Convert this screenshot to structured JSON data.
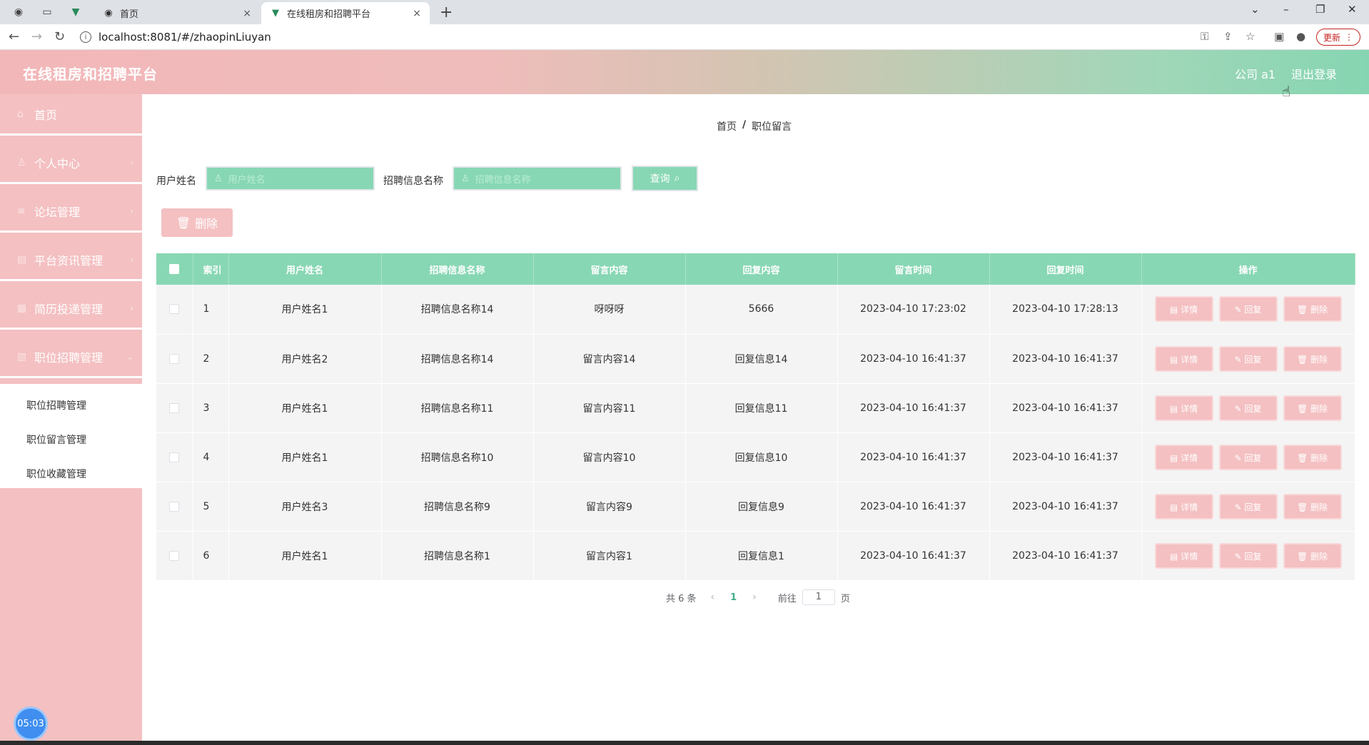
{
  "browser": {
    "tabs": [
      {
        "title": "首页",
        "close": "×"
      },
      {
        "title": "在线租房和招聘平台",
        "close": "×"
      }
    ],
    "new_tab": "+",
    "url": "localhost:8081/#/zhaopinLiuyan",
    "update_label": "更新"
  },
  "header": {
    "title": "在线租房和招聘平台",
    "user": "公司 a1",
    "logout": "退出登录"
  },
  "sidebar": {
    "items": [
      {
        "label": "首页"
      },
      {
        "label": "个人中心"
      },
      {
        "label": "论坛管理"
      },
      {
        "label": "平台资讯管理"
      },
      {
        "label": "简历投递管理"
      },
      {
        "label": "职位招聘管理"
      }
    ],
    "submenu": [
      {
        "label": "职位招聘管理"
      },
      {
        "label": "职位留言管理"
      },
      {
        "label": "职位收藏管理"
      }
    ],
    "clock": "05:03"
  },
  "breadcrumb": {
    "home": "首页",
    "sep": "/",
    "current": "职位留言"
  },
  "search": {
    "user_label": "用户姓名",
    "user_placeholder": "用户姓名",
    "job_label": "招聘信息名称",
    "job_placeholder": "招聘信息名称",
    "query_label": "查询"
  },
  "delete_label": "删除",
  "table": {
    "headers": [
      "索引",
      "用户姓名",
      "招聘信息名称",
      "留言内容",
      "回复内容",
      "留言时间",
      "回复时间",
      "操作"
    ],
    "actions": {
      "detail": "详情",
      "reply": "回复",
      "delete": "删除"
    },
    "rows": [
      {
        "idx": "1",
        "user": "用户姓名1",
        "job": "招聘信息名称14",
        "content": "呀呀呀",
        "reply": "5666",
        "time": "2023-04-10 17:23:02",
        "reply_time": "2023-04-10 17:28:13"
      },
      {
        "idx": "2",
        "user": "用户姓名2",
        "job": "招聘信息名称14",
        "content": "留言内容14",
        "reply": "回复信息14",
        "time": "2023-04-10 16:41:37",
        "reply_time": "2023-04-10 16:41:37"
      },
      {
        "idx": "3",
        "user": "用户姓名1",
        "job": "招聘信息名称11",
        "content": "留言内容11",
        "reply": "回复信息11",
        "time": "2023-04-10 16:41:37",
        "reply_time": "2023-04-10 16:41:37"
      },
      {
        "idx": "4",
        "user": "用户姓名1",
        "job": "招聘信息名称10",
        "content": "留言内容10",
        "reply": "回复信息10",
        "time": "2023-04-10 16:41:37",
        "reply_time": "2023-04-10 16:41:37"
      },
      {
        "idx": "5",
        "user": "用户姓名3",
        "job": "招聘信息名称9",
        "content": "留言内容9",
        "reply": "回复信息9",
        "time": "2023-04-10 16:41:37",
        "reply_time": "2023-04-10 16:41:37"
      },
      {
        "idx": "6",
        "user": "用户姓名1",
        "job": "招聘信息名称1",
        "content": "留言内容1",
        "reply": "回复信息1",
        "time": "2023-04-10 16:41:37",
        "reply_time": "2023-04-10 16:41:37"
      }
    ]
  },
  "pagination": {
    "total": "共 6 条",
    "page": "1",
    "goto": "前往",
    "goto_value": "1",
    "page_suffix": "页"
  }
}
